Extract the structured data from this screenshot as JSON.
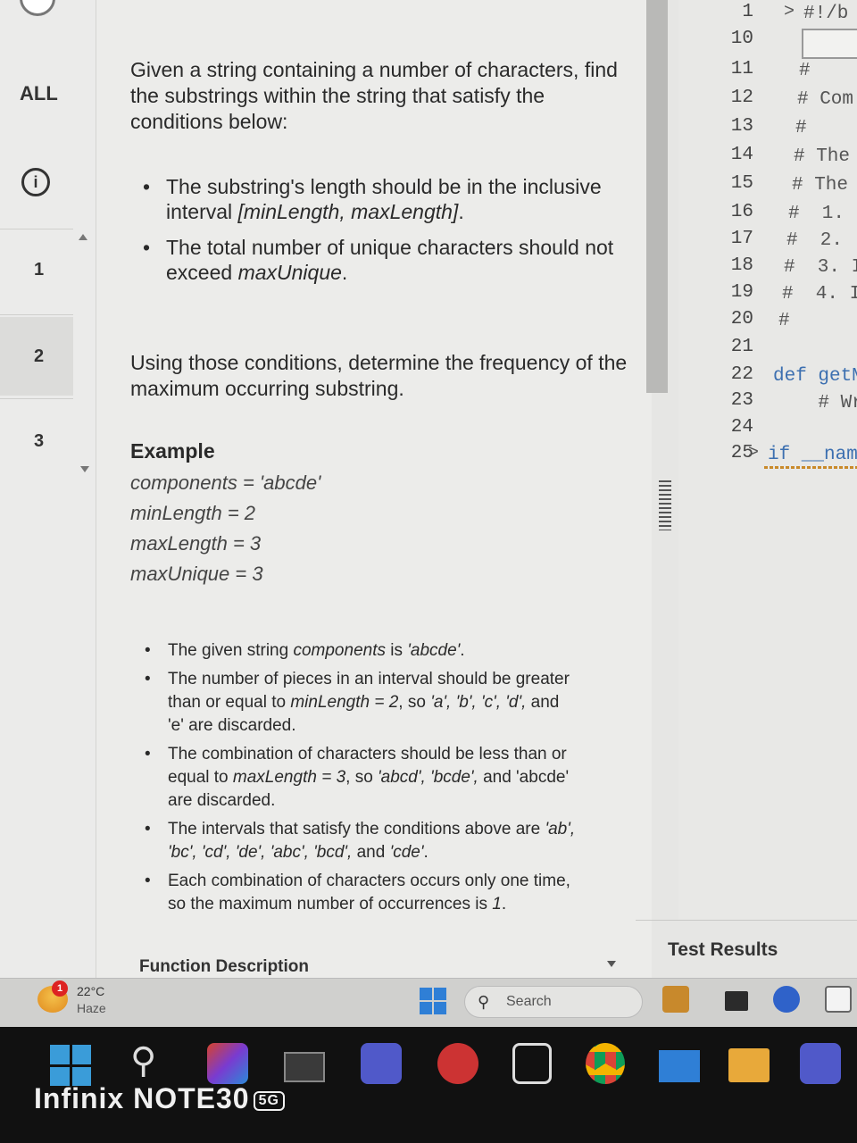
{
  "nav": {
    "all_label": "ALL",
    "info_icon": "info-icon",
    "questions": [
      "1",
      "2",
      "3"
    ]
  },
  "problem": {
    "intro": "Given a string containing a number of characters, find the substrings within the string that satisfy the conditions below:",
    "conditions": [
      {
        "text1": "The substring's length should be in the inclusive interval ",
        "em": "[minLength, maxLength]",
        "text2": "."
      },
      {
        "text1": "The total number of unique characters should not exceed ",
        "em": "maxUnique",
        "text2": "."
      }
    ],
    "goal": "Using those conditions, determine the frequency of the maximum occurring substring.",
    "example_heading": "Example",
    "example_lines": [
      "components = 'abcde'",
      "minLength = 2",
      "maxLength = 3",
      "maxUnique = 3"
    ],
    "explanation": [
      {
        "a": "The given string ",
        "em": "components",
        "b": " is ",
        "em2": "'abcde'",
        "c": "."
      },
      {
        "a": "The number of pieces in an interval should be greater than or equal to ",
        "em": "minLength = 2",
        "b": ", so ",
        "em2": "'a', 'b', 'c', 'd',",
        "c": " and 'e' are discarded."
      },
      {
        "a": "The combination of characters should be less than or equal to ",
        "em": "maxLength = 3",
        "b": ", so ",
        "em2": "'abcd', 'bcde',",
        "c": " and 'abcde' are discarded."
      },
      {
        "a": "The intervals that satisfy the conditions above are ",
        "em": "'ab', 'bc', 'cd', 'de', 'abc', 'bcd',",
        "b": " and ",
        "em2": "'cde'",
        "c": "."
      },
      {
        "a": "Each combination of characters occurs only one time, so the maximum number of occurrences is ",
        "em": "1",
        "b": ".",
        "em2": "",
        "c": ""
      }
    ],
    "function_description": "Function Description"
  },
  "editor": {
    "line_numbers": [
      "1",
      "10",
      "11",
      "12",
      "13",
      "14",
      "15",
      "16",
      "17",
      "18",
      "19",
      "20",
      "21",
      "22",
      "23",
      "24",
      "25"
    ],
    "code_lines": [
      "#!/b",
      "",
      "#",
      "# Com",
      "#",
      "# The",
      "# The",
      "#  1.",
      "#  2.",
      "#  3. I",
      "#  4. I",
      "#",
      "",
      "def getM",
      "    # Wr",
      "",
      "if __name"
    ]
  },
  "test_results_label": "Test Results",
  "taskbar": {
    "temperature": "22°C",
    "weather": "Haze",
    "weather_badge": "1",
    "search_label": "Search"
  },
  "device": {
    "brand": "Infinix NOTE30",
    "badge": "5G"
  },
  "colors": {
    "keyword": "#3c6fb0",
    "windows_blue": "#2f7fd6"
  }
}
